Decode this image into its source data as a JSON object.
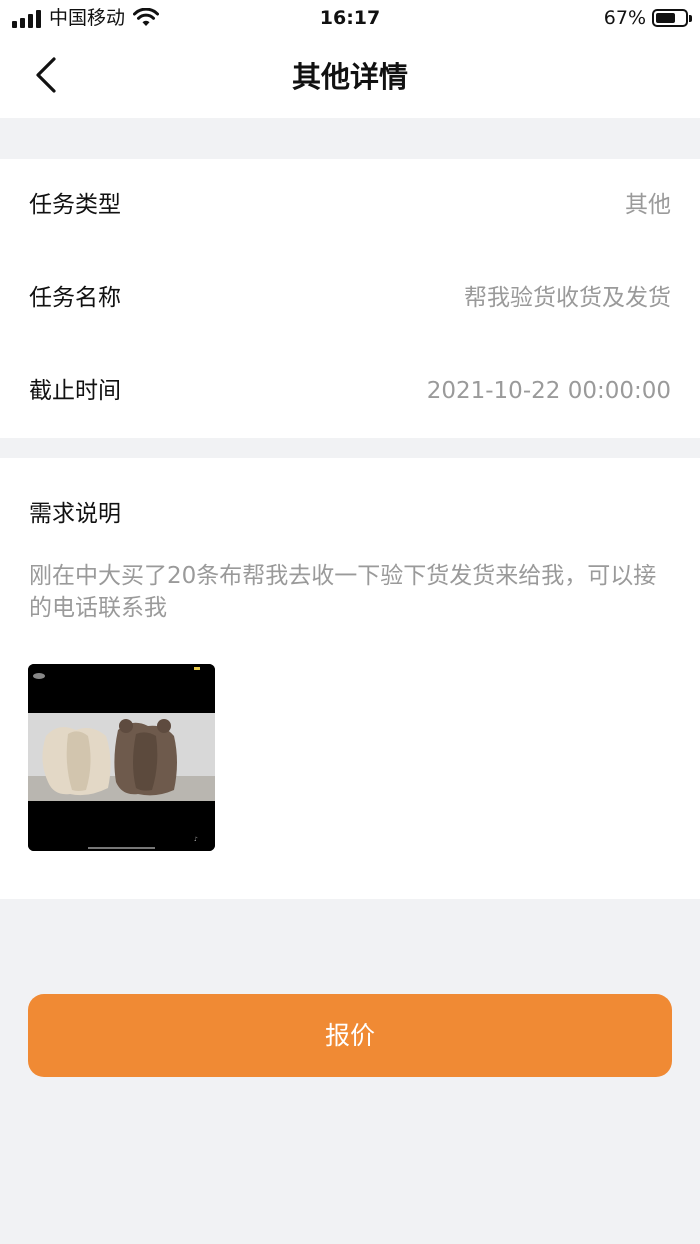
{
  "status_bar": {
    "carrier": "中国移动",
    "time": "16:17",
    "battery": "67%",
    "battery_level": 0.67,
    "signal_icon": "signal-icon",
    "wifi_icon": "wifi-icon"
  },
  "nav": {
    "title": "其他详情",
    "back_icon": "back-chevron-icon"
  },
  "details": [
    {
      "label": "任务类型",
      "value": "其他"
    },
    {
      "label": "任务名称",
      "value": "帮我验货收货及发货"
    },
    {
      "label": "截止时间",
      "value": "2021-10-22 00:00:00"
    }
  ],
  "description": {
    "title": "需求说明",
    "text": "刚在中大买了20条布帮我去收一下验下货发货来给我，可以接的电话联系我"
  },
  "quote_button": {
    "label": "报价",
    "color": "#f08a34"
  }
}
